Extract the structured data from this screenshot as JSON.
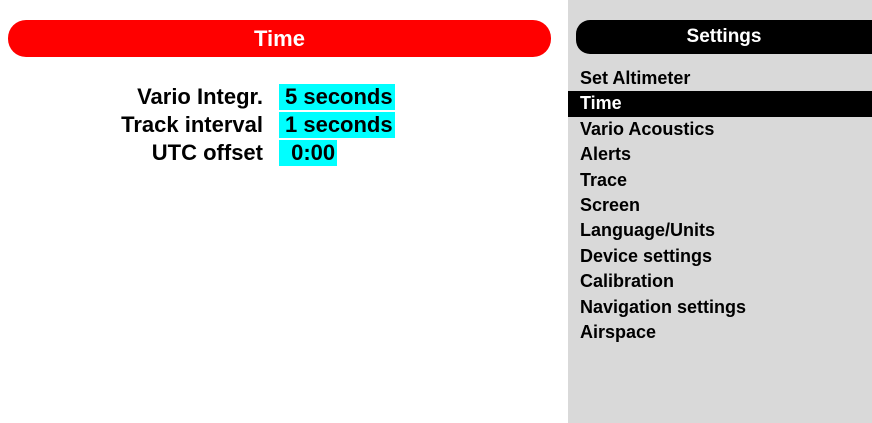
{
  "left": {
    "title": "Time",
    "settings": [
      {
        "label": "Vario Integr.",
        "value": "5 seconds"
      },
      {
        "label": "Track interval",
        "value": "1 seconds"
      },
      {
        "label": "UTC offset",
        "value": " 0:00"
      }
    ]
  },
  "menu": {
    "title": "Settings",
    "selected_index": 1,
    "items": [
      {
        "label": "Set Altimeter"
      },
      {
        "label": "Time"
      },
      {
        "label": "Vario Acoustics"
      },
      {
        "label": "Alerts"
      },
      {
        "label": "Trace"
      },
      {
        "label": "Screen"
      },
      {
        "label": "Language/Units"
      },
      {
        "label": "Device settings"
      },
      {
        "label": "Calibration"
      },
      {
        "label": "Navigation settings"
      },
      {
        "label": "Airspace"
      }
    ]
  },
  "colors": {
    "title_bar": "#ff0000",
    "value_highlight": "#00ffff",
    "menu_background": "#d9d9d9",
    "menu_selected": "#000000"
  }
}
